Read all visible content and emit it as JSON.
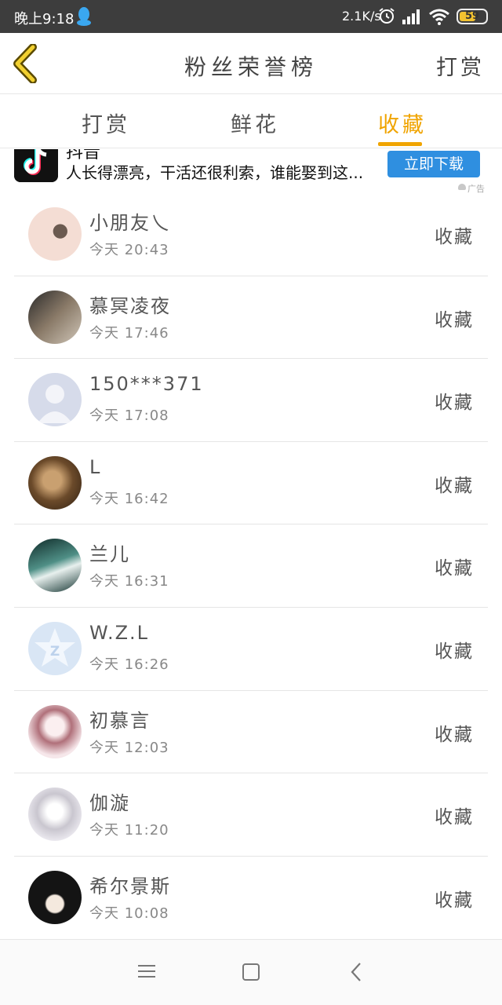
{
  "status_bar": {
    "time": "晚上9:18",
    "net_speed": "2.1K/s",
    "battery": "59",
    "icons": [
      "qq-icon",
      "alarm-icon",
      "signal-icon",
      "wifi-icon",
      "battery-icon"
    ]
  },
  "header": {
    "title": "粉丝荣誉榜",
    "right_button": "打赏"
  },
  "tabs": [
    {
      "label": "打赏",
      "active": false
    },
    {
      "label": "鲜花",
      "active": false
    },
    {
      "label": "收藏",
      "active": true
    }
  ],
  "ad": {
    "title": "抖音",
    "text": "人长得漂亮，干活还很利索，谁能娶到这...",
    "button": "立即下载",
    "tag": "广告"
  },
  "rows": [
    {
      "name": "小朋友乀",
      "time": "今天 20:43",
      "action": "收藏"
    },
    {
      "name": "慕冥凌夜",
      "time": "今天 17:46",
      "action": "收藏"
    },
    {
      "name": "150***371",
      "time": "今天 17:08",
      "action": "收藏"
    },
    {
      "name": "L",
      "time": "今天 16:42",
      "action": "收藏"
    },
    {
      "name": "兰儿",
      "time": "今天 16:31",
      "action": "收藏"
    },
    {
      "name": "W.Z.L",
      "time": "今天 16:26",
      "action": "收藏"
    },
    {
      "name": "初慕言",
      "time": "今天 12:03",
      "action": "收藏"
    },
    {
      "name": "伽漩",
      "time": "今天 11:20",
      "action": "收藏"
    },
    {
      "name": "希尔景斯",
      "time": "今天 10:08",
      "action": "收藏"
    }
  ],
  "colors": {
    "accent": "#f0a400",
    "status_bar": "#3d3d3d",
    "ad_button": "#2f8fe0"
  }
}
